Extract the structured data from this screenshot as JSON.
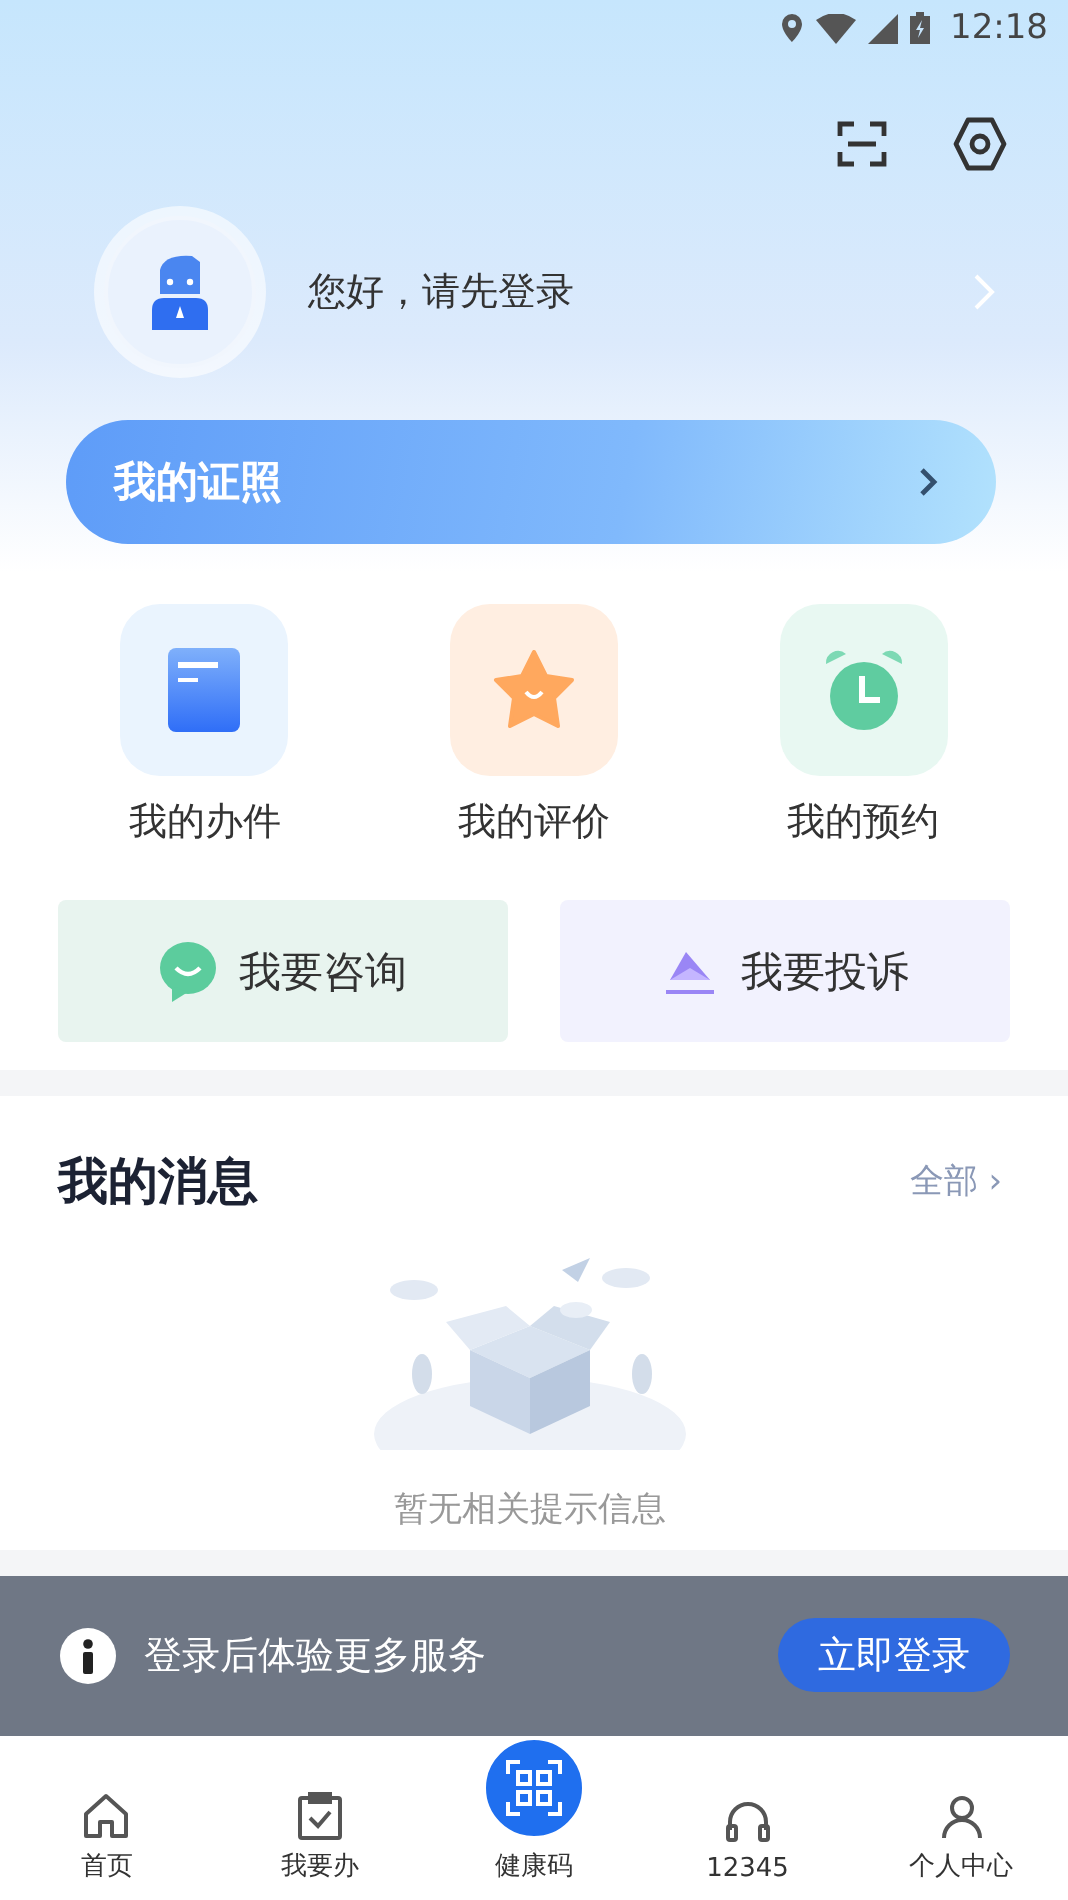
{
  "status_bar": {
    "time": "12:18"
  },
  "profile": {
    "greeting": "您好，请先登录"
  },
  "certificate": {
    "label": "我的证照"
  },
  "shortcuts": [
    {
      "kind": "document",
      "label": "我的办件"
    },
    {
      "kind": "star",
      "label": "我的评价"
    },
    {
      "kind": "alarm",
      "label": "我的预约"
    }
  ],
  "actions": [
    {
      "kind": "consult",
      "label": "我要咨询"
    },
    {
      "kind": "complain",
      "label": "我要投诉"
    }
  ],
  "messages": {
    "title": "我的消息",
    "more": "全部 ›",
    "empty_text": "暂无相关提示信息"
  },
  "login_banner": {
    "text": "登录后体验更多服务",
    "button": "立即登录"
  },
  "bottom_nav": [
    {
      "kind": "home",
      "label": "首页"
    },
    {
      "kind": "clipboard",
      "label": "我要办"
    },
    {
      "kind": "qr",
      "label": "健康码"
    },
    {
      "kind": "headset",
      "label": "12345"
    },
    {
      "kind": "person",
      "label": "个人中心"
    }
  ]
}
